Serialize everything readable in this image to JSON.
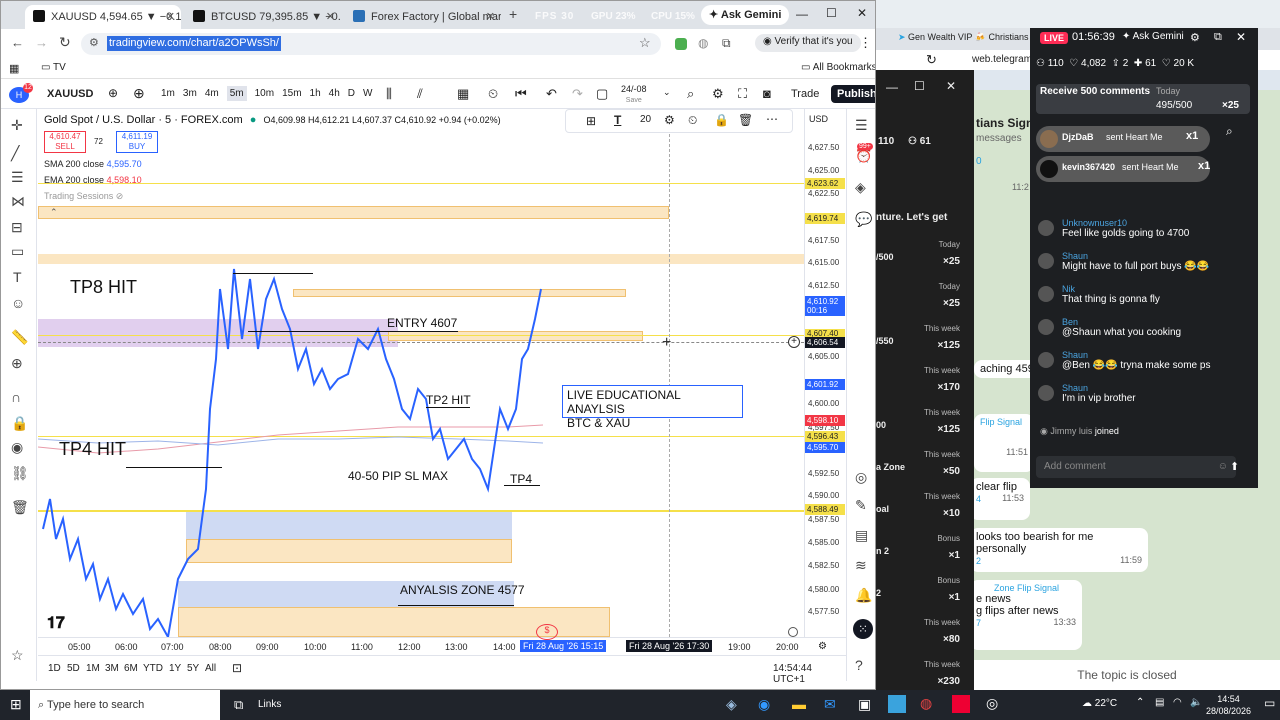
{
  "browser": {
    "tabs": [
      {
        "label": "XAUUSD 4,594.65 ▼ −0.15% 2",
        "active": true
      },
      {
        "label": "BTCUSD 79,395.85 ▼ −0.86% 2",
        "active": false
      },
      {
        "label": "Forex Factory | Global markets",
        "active": false
      }
    ],
    "perf": {
      "fps": "FPS 30",
      "gpu": "GPU 23%",
      "cpu": "CPU 15%"
    },
    "ask_gemini": "Ask Gemini",
    "url": "tradingview.com/chart/a2OPWsSh/",
    "verify": "Verify that it's you",
    "bookmark_tv": "TV",
    "all_bookmarks": "All Bookmarks"
  },
  "tv": {
    "symbol": "XAUUSD",
    "intervals": [
      "1m",
      "3m",
      "4m",
      "5m",
      "10m",
      "15m",
      "1h",
      "4h",
      "D",
      "W"
    ],
    "active_interval": "5m",
    "date_label": "24/-08",
    "save_label": "Save",
    "trade": "Trade",
    "publish": "Publish",
    "title": "Gold Spot / U.S. Dollar · 5 · FOREX.com",
    "ohlc": "O4,609.98 H4,612.21 L4,607.37 C4,610.92 +0.94 (+0.02%)",
    "sell_price": "4,610.47",
    "sell_label": "SELL",
    "spread": "72",
    "buy_price": "4,611.19",
    "buy_label": "BUY",
    "sma_label": "SMA 200 close",
    "sma_value": "4,595.70",
    "ema_label": "EMA 200 close",
    "ema_value": "4,598.10",
    "sessions_label": "Trading Sessions",
    "draw_toolbar_size": "20",
    "currency": "USD",
    "annotations": {
      "tp8": "TP8 HIT",
      "entry": "ENTRY 4607",
      "tp2": "TP2 HIT",
      "tp4hit": "TP4 HIT",
      "sl": "40-50 PIP SL MAX",
      "tp4": "TP4",
      "live_line1": "LIVE EDUCATIONAL ANAYLSIS",
      "live_line2": "BTC & XAU",
      "zone": "ANYALSIS ZONE 4577"
    },
    "price_ticks": [
      "4,627.50",
      "4,625.00",
      "4,622.50",
      "4,617.50",
      "4,615.00",
      "4,612.50",
      "4,605.00",
      "4,600.00",
      "4,597.50",
      "4,592.50",
      "4,590.00",
      "4,585.00",
      "4,582.50",
      "4,580.00",
      "4,577.50"
    ],
    "price_boxes": {
      "p1": "4,623.62",
      "p2": "4,619.74",
      "p3": "4,610.92",
      "p3b": "00:16",
      "p4": "4,607.40",
      "p5": "4,606.54",
      "p6": "4,601.92",
      "p7": "4,598.10",
      "p8": "4,596.43",
      "p9": "4,595.70",
      "p10": "4,588.49",
      "p11": "4,587.50"
    },
    "time_ticks": [
      "05:00",
      "06:00",
      "07:00",
      "08:00",
      "09:00",
      "10:00",
      "11:00",
      "12:00",
      "13:00",
      "14:00",
      "19:00",
      "20:00"
    ],
    "time_cursor1": "Fri 28 Aug '26  15:15",
    "time_cursor2": "Fri 28 Aug '26  17:30",
    "ranges": [
      "1D",
      "5D",
      "1M",
      "3M",
      "6M",
      "YTD",
      "1Y",
      "5Y",
      "All"
    ],
    "clock": "14:54:44 UTC+1",
    "notif_badge": "99+"
  },
  "telegram": {
    "tab1": "Gen Wealth VIP 🍻 Christians",
    "url": "web.telegram.o",
    "header_subs": "110",
    "header_count": "61",
    "channel_title": "tians Signals",
    "channel_sub": "messages",
    "msg_tune": "nture. Let's get",
    "msg_reaching": "aching 4599 buy z",
    "msg_flip": "clear flip",
    "msg_bearish": "looks too bearish for me personally",
    "msg_zone_sig": "Zone Flip Signal",
    "msg_news": "e news",
    "msg_flips": "g flips after news",
    "time1": "11:51",
    "time2": "11:53",
    "time3": "11:59",
    "time4": "13:33",
    "time5": "11:2",
    "count1": "4",
    "count2": "2",
    "count3": "7",
    "flip_signal_label": "Flip Signal",
    "topic_closed": "The topic is closed",
    "dark_rows": [
      {
        "h": "Today",
        "v": "×25",
        "l": "/500"
      },
      {
        "h": "Today",
        "v": "×25",
        "l": ""
      },
      {
        "h": "This week",
        "v": "×125",
        "l": "/550"
      },
      {
        "h": "This week",
        "v": "×170",
        "l": ""
      },
      {
        "h": "This week",
        "v": "×125",
        "l": "00"
      },
      {
        "h": "This week",
        "v": "×50",
        "l": "a Zone"
      },
      {
        "h": "This week",
        "v": "×10",
        "l": "oal"
      },
      {
        "h": "Bonus",
        "v": "×1",
        "l": "n 2"
      },
      {
        "h": "Bonus",
        "v": "×1",
        "l": "2"
      },
      {
        "h": "This week",
        "v": "×80",
        "l": ""
      },
      {
        "h": "This week",
        "v": "×230",
        "l": ""
      }
    ]
  },
  "live": {
    "badge": "LIVE",
    "timer": "01:56:39",
    "ask": "Ask Gemini",
    "stats": {
      "viewers": "110",
      "likes": "4,082",
      "two": "2",
      "sixty": "61",
      "hearts": "20 K"
    },
    "goal": "Receive 500 comments",
    "goal_progress": "495/500",
    "goal_reward": "×25",
    "today": "Today",
    "gifts": [
      {
        "user": "DjzDaB",
        "text": "sent Heart Me",
        "mult": "x1"
      },
      {
        "user": "kevin367420",
        "text": "sent Heart Me",
        "mult": "x1"
      }
    ],
    "chat": [
      {
        "name": "Unknownuser10",
        "msg": "Feel like golds going to 4700"
      },
      {
        "name": "Shaun",
        "msg": "Might have to full port buys 😂😂"
      },
      {
        "name": "Nik",
        "msg": "That thing is gonna fly"
      },
      {
        "name": "Ben",
        "msg": "@Shaun what you cooking"
      },
      {
        "name": "Shaun",
        "msg": "@Ben 😂😂 tryna make some ps"
      },
      {
        "name": "Shaun",
        "msg": "I'm in vip brother"
      }
    ],
    "joined_user": "Jimmy luis",
    "joined_label": "joined",
    "comment_placeholder": "Add comment"
  },
  "taskbar": {
    "search": "Type here to search",
    "links": "Links",
    "weather": "22°C",
    "time": "14:54",
    "date": "28/08/2026"
  }
}
